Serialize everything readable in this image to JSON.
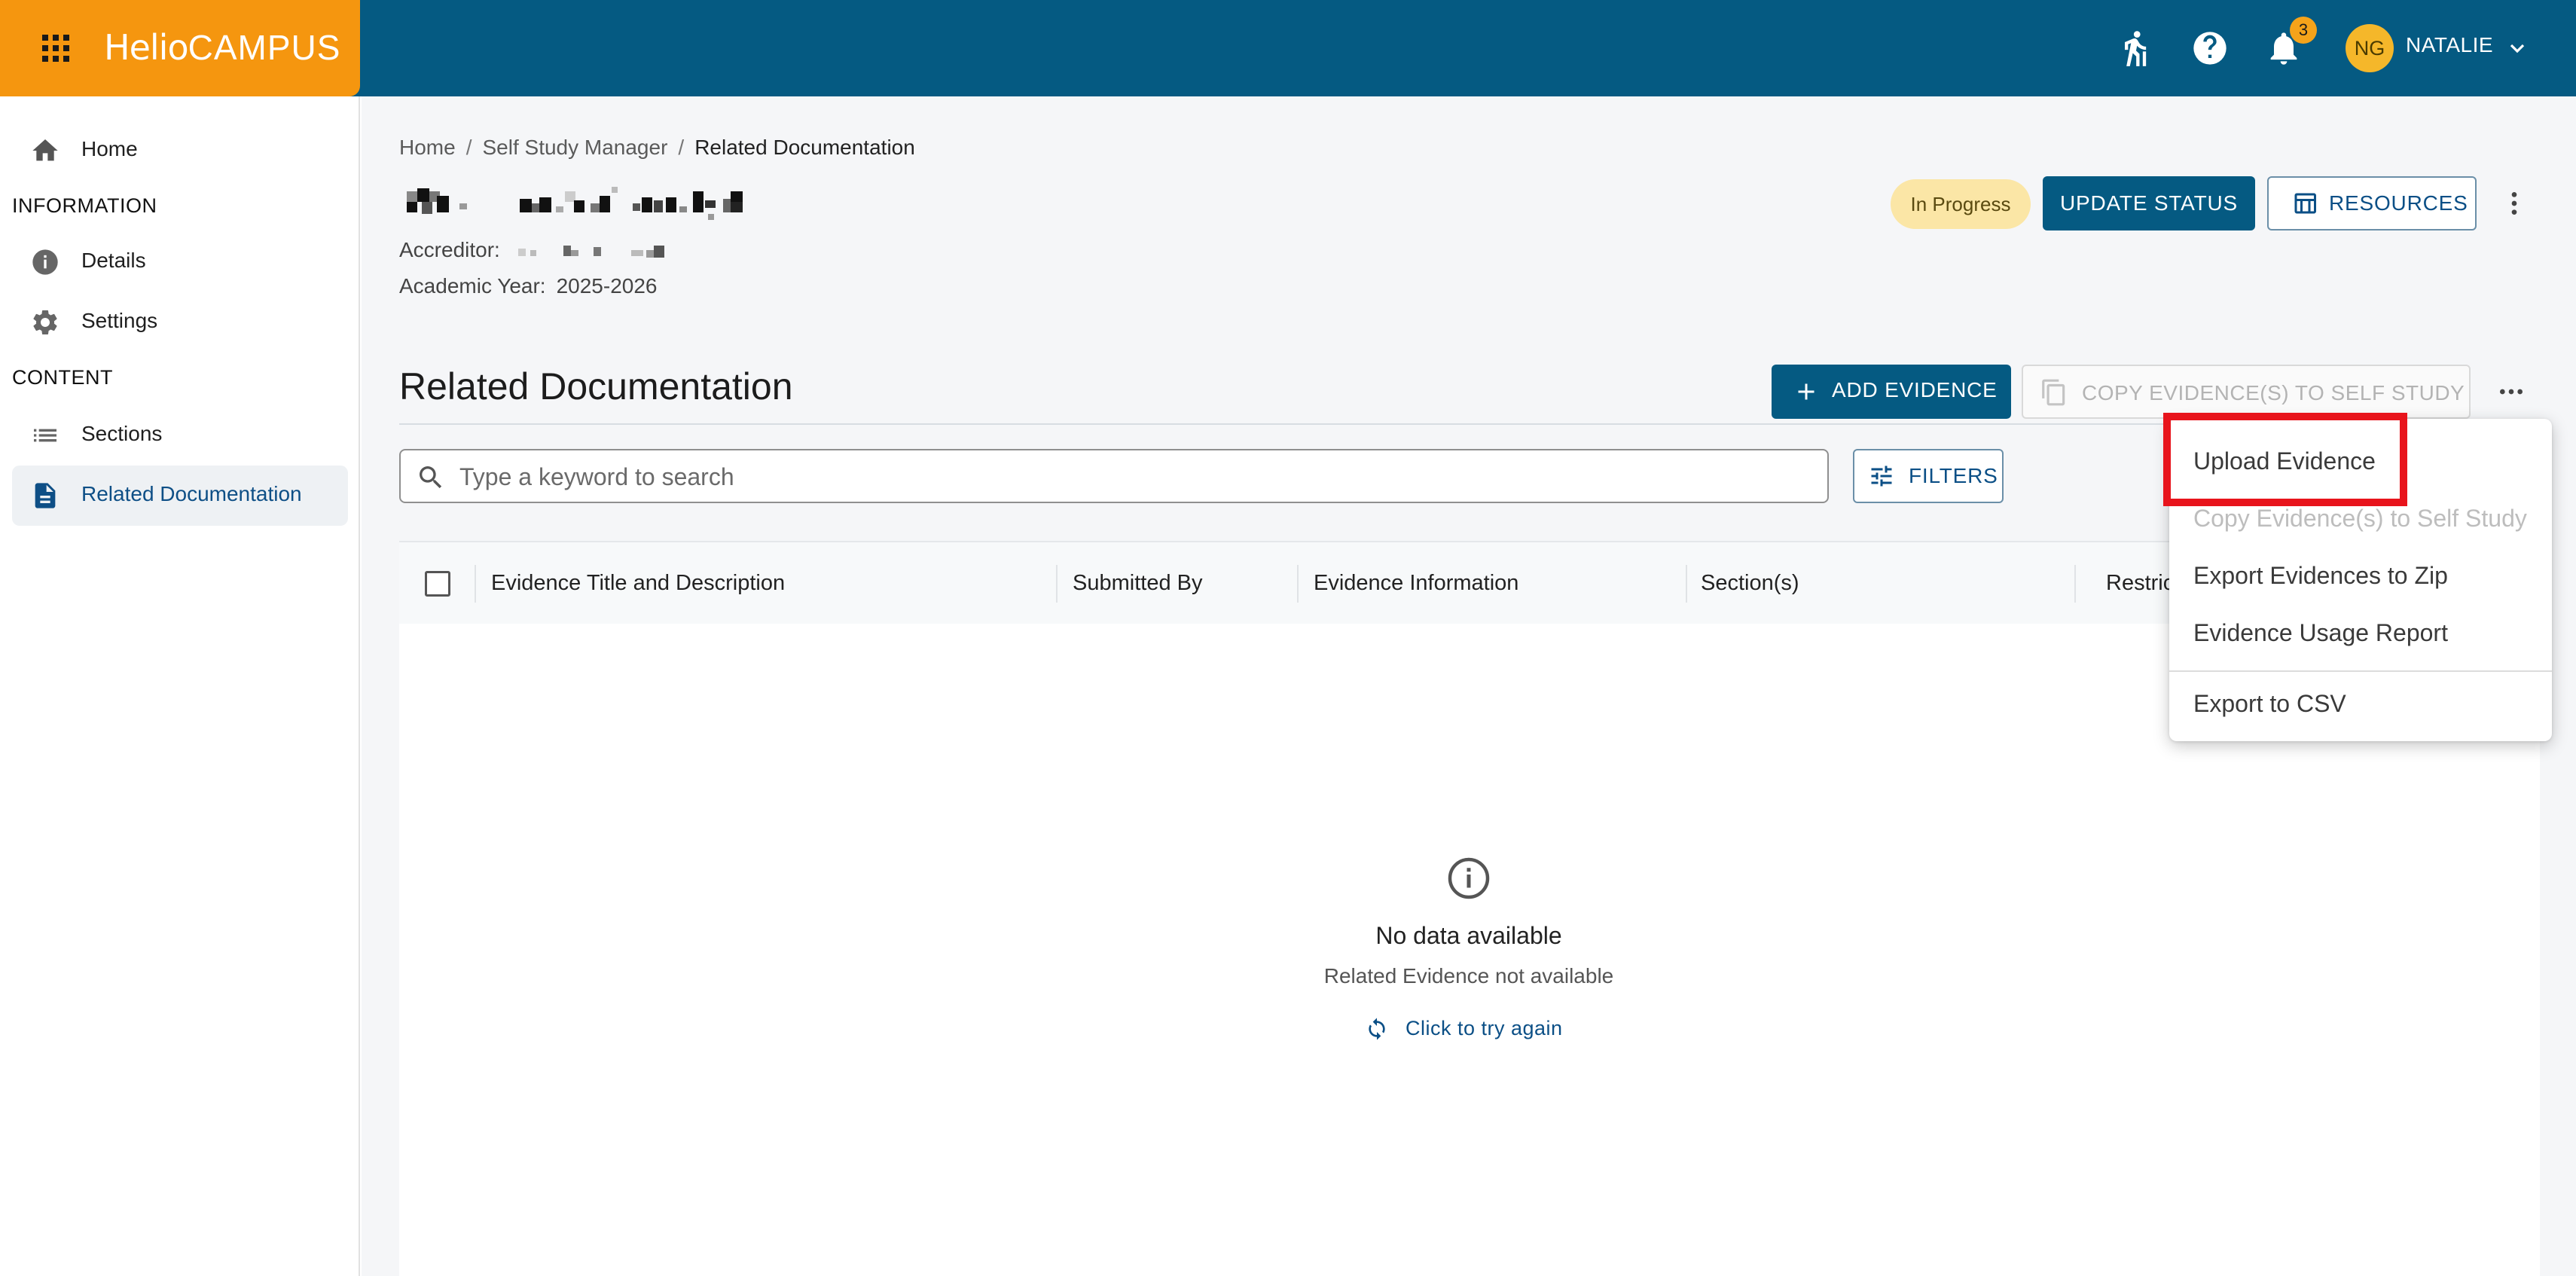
{
  "header": {
    "brand_part1": "Helio",
    "brand_part2": "CAMPUS",
    "notification_count": "3",
    "user_initials": "NG",
    "user_name": "NATALIE",
    "icons": [
      "apps-grid-icon",
      "walkthrough-icon",
      "help-icon",
      "notification-bell-icon",
      "chevron-down-icon"
    ],
    "colors": {
      "topbar": "#055a82",
      "brand_block": "#f5960f",
      "avatar": "#f5b72a",
      "badge": "#f5a31a"
    }
  },
  "sidebar": {
    "home": {
      "label": "Home",
      "icon": "home-icon"
    },
    "section_information": "INFORMATION",
    "details": {
      "label": "Details",
      "icon": "info-icon"
    },
    "settings": {
      "label": "Settings",
      "icon": "gear-icon"
    },
    "section_content": "CONTENT",
    "sections": {
      "label": "Sections",
      "icon": "list-icon"
    },
    "related_docs": {
      "label": "Related Documentation",
      "icon": "document-icon"
    }
  },
  "breadcrumb": {
    "home": "Home",
    "self_study": "Self Study Manager",
    "current": "Related Documentation"
  },
  "study": {
    "accreditor_label": "Accreditor:",
    "year_label": "Academic Year:",
    "year_value": "2025-2026",
    "status": "In Progress"
  },
  "actions": {
    "update_status": "UPDATE STATUS",
    "resources": "RESOURCES",
    "add_evidence": "ADD EVIDENCE",
    "copy_evidence": "COPY EVIDENCE(S) TO SELF STUDY",
    "filters": "FILTERS"
  },
  "page": {
    "title": "Related Documentation",
    "search_placeholder": "Type a keyword to search"
  },
  "table": {
    "columns": [
      "Evidence Title and Description",
      "Submitted By",
      "Evidence Information",
      "Section(s)",
      "Restric"
    ]
  },
  "empty_state": {
    "title": "No data available",
    "subtitle": "Related Evidence not available",
    "retry": "Click to try again"
  },
  "menu": {
    "items": [
      {
        "label": "Upload Evidence",
        "enabled": true
      },
      {
        "label": "Copy Evidence(s) to Self Study",
        "enabled": false
      },
      {
        "label": "Export Evidences to Zip",
        "enabled": true
      },
      {
        "label": "Evidence Usage Report",
        "enabled": true
      },
      {
        "label": "Export to CSV",
        "enabled": true
      }
    ],
    "highlight_color": "#e8141c"
  }
}
